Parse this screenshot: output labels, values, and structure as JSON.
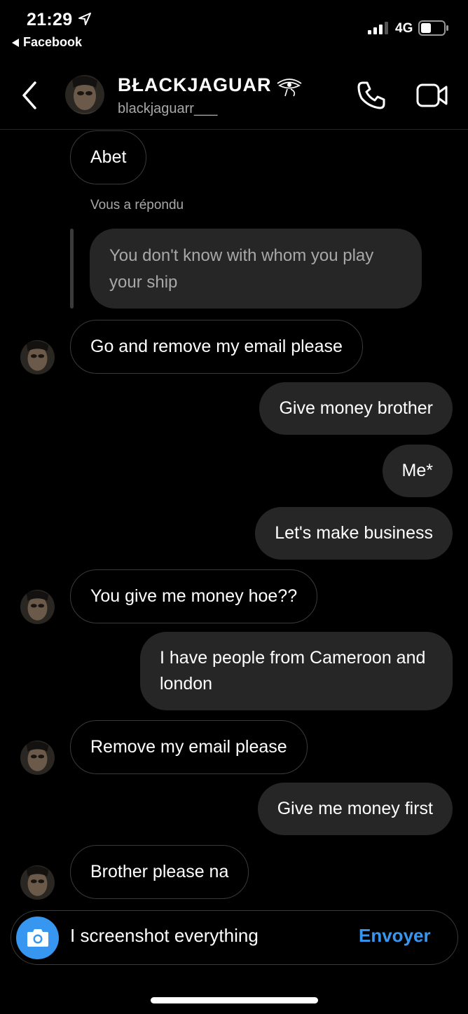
{
  "status_bar": {
    "time": "21:29",
    "back_app": "Facebook",
    "network": "4G"
  },
  "header": {
    "display_name": "𝔅𝔏𝔄𝔆𝔎𝔍𝔄𝔊𝔘𝔄ℜ",
    "display_name_render": "BŁACKJAGUAR",
    "username": "blackjaguarr___"
  },
  "messages": [
    {
      "from": "them",
      "text": "Abet"
    },
    {
      "reply_label": "Vous a répondu",
      "quoted": "You don't know with whom you play your ship"
    },
    {
      "from": "them",
      "text": "Go and remove my email please"
    },
    {
      "from": "me",
      "text": "Give money brother"
    },
    {
      "from": "me",
      "text": "Me*"
    },
    {
      "from": "me",
      "text": "Let's make business"
    },
    {
      "from": "them",
      "text": "You give me money hoe??"
    },
    {
      "from": "me",
      "text": "I have people from Cameroon and london"
    },
    {
      "from": "them",
      "text": "Remove my email please"
    },
    {
      "from": "me",
      "text": "Give me money first"
    },
    {
      "from": "them",
      "text": "Brother please na"
    }
  ],
  "composer": {
    "value": "I screenshot everything",
    "send_label": "Envoyer"
  },
  "colors": {
    "accent": "#3797f0",
    "bubble_out": "#262626",
    "muted_text": "#a8a8a8"
  }
}
